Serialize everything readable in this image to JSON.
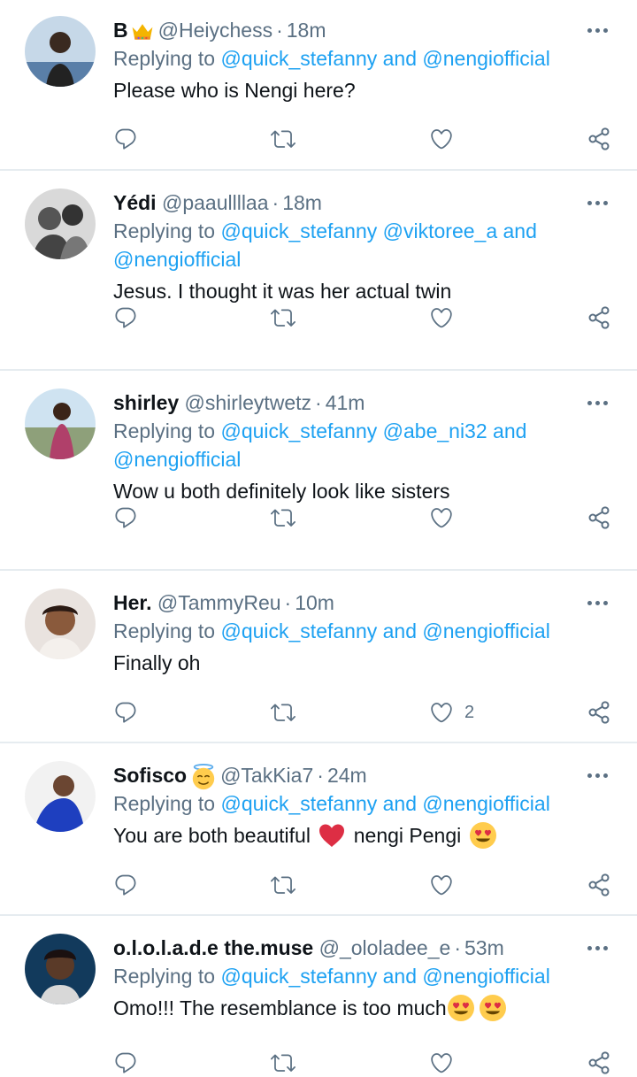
{
  "tweets": [
    {
      "name": "B",
      "name_emoji": "crown",
      "handle": "@Heiychess",
      "time": "18m",
      "replying_prefix": "Replying to",
      "replying_1": "@quick_stefanny",
      "replying_and": "and",
      "replying_2": "@nengiofficial",
      "replying_3": "",
      "text": "Please who is Nengi here?",
      "like_count": ""
    },
    {
      "name": "Yédi",
      "handle": "@paaullllaa",
      "time": "18m",
      "replying_prefix": "Replying to",
      "replying_1": "@quick_stefanny",
      "replying_2": "@viktoree_a",
      "replying_and": "and",
      "replying_3": "@nengiofficial",
      "text": "Jesus. I thought it was her actual twin",
      "like_count": ""
    },
    {
      "name": "shirley",
      "handle": "@shirleytwetz",
      "time": "41m",
      "replying_prefix": "Replying to",
      "replying_1": "@quick_stefanny",
      "replying_2": "@abe_ni32",
      "replying_and": "and",
      "replying_3": "@nengiofficial",
      "text": "Wow u both definitely look like sisters",
      "like_count": ""
    },
    {
      "name": "Her.",
      "handle": "@TammyReu",
      "time": "10m",
      "replying_prefix": "Replying to",
      "replying_1": "@quick_stefanny",
      "replying_and": "and",
      "replying_2": "@nengiofficial",
      "text": "Finally oh",
      "like_count": "2"
    },
    {
      "name": "Sofisco",
      "name_emoji": "smiling-face-with-halo",
      "handle": "@TakKia7",
      "time": "24m",
      "replying_prefix": "Replying to",
      "replying_1": "@quick_stefanny",
      "replying_and": "and",
      "replying_2": "@nengiofficial",
      "text_a": "You are both beautiful",
      "text_emoji_1": "red-heart",
      "text_b": "nengi Pengi",
      "text_emoji_2": "heart-eyes",
      "like_count": ""
    },
    {
      "name": "o.l.o.l.a.d.e the.muse",
      "handle": "@_ololadee_e",
      "time": "53m",
      "replying_prefix": "Replying to",
      "replying_1": "@quick_stefanny",
      "replying_and": "and",
      "replying_2": "@nengiofficial",
      "text": "Omo!!! The resemblance is too much",
      "text_emojis": [
        "heart-eyes",
        "heart-eyes"
      ],
      "like_count": ""
    }
  ],
  "separator": "·",
  "icons": {
    "reply": "reply-icon",
    "retweet": "retweet-icon",
    "like": "like-icon",
    "share": "share-icon",
    "more": "more-icon"
  },
  "colors": {
    "accent": "#1da1f2",
    "secondary_text": "#5b7083",
    "primary_text": "#0f1419",
    "divider": "#e6ecf0"
  }
}
